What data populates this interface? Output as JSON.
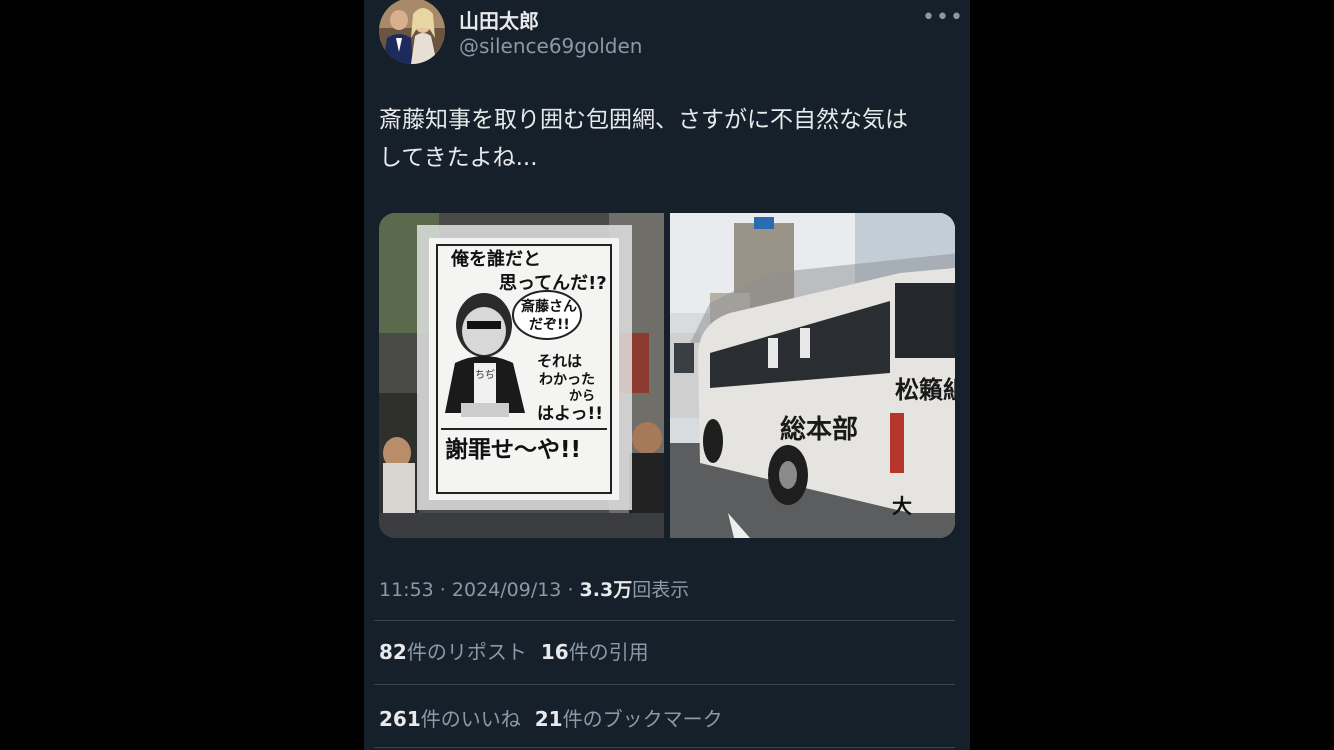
{
  "author": {
    "display_name": "山田太郎",
    "handle": "@silence69golden"
  },
  "tweet": {
    "text_line1": "斎藤知事を取り囲む包囲網、さすがに不自然な気は",
    "text_line2": "してきたよね..."
  },
  "media": {
    "left_photo": {
      "poster_lines": [
        "俺を誰だと",
        "思ってんだ!?"
      ],
      "bubble_lines": [
        "斎藤さん",
        "だぞ!!"
      ],
      "shirt_text": "ちぢ",
      "middle_lines": [
        "それは",
        "わかった",
        "から",
        "はよっ!!"
      ],
      "bottom_line": "謝罪せ〜や!!"
    },
    "right_photo": {
      "bus_side_text": "総本部",
      "bus_rear_text": "松籟組",
      "bus_bottom_char": "大"
    }
  },
  "meta": {
    "time": "11:53",
    "sep": " · ",
    "date": "2024/09/13",
    "views_num": "3.3万",
    "views_label": "回表示"
  },
  "stats": {
    "reposts_num": "82",
    "reposts_label": "件のリポスト",
    "quotes_num": "16",
    "quotes_label": "件の引用",
    "likes_num": "261",
    "likes_label": "件のいいね",
    "bookmarks_num": "21",
    "bookmarks_label": "件のブックマーク"
  },
  "icons": {
    "more": "more-dots-icon"
  }
}
